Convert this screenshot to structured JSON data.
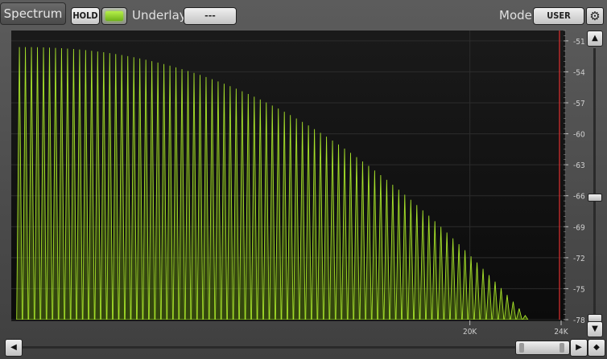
{
  "header": {
    "title": "Spectrum",
    "hold_label": "HOLD",
    "underlay_label": "Underlay",
    "underlay_value": "---",
    "mode_label": "Mode",
    "mode_value": "USER"
  },
  "colors": {
    "spectrum": "#a6e22a",
    "plot_bg": "#111111",
    "cursor_line": "#e03030",
    "led": "#8ad02a"
  },
  "icons": {
    "settings": "gear-icon",
    "scroll_up": "triangle-up-icon",
    "scroll_down": "triangle-down-icon",
    "scroll_left": "triangle-left-icon",
    "scroll_right": "triangle-right-icon",
    "zoom": "diamond-icon"
  },
  "axes": {
    "y_tick_labels": [
      "-51",
      "-54",
      "-57",
      "-60",
      "-63",
      "-66",
      "-69",
      "-72",
      "-75",
      "-78"
    ],
    "x_tick_labels": [
      "20K",
      "24K"
    ]
  },
  "chart_data": {
    "type": "bar",
    "xlabel": "",
    "ylabel": "",
    "xlim": [
      0,
      24000
    ],
    "ylim": [
      -78,
      -50
    ],
    "x_ticks": [
      20000,
      24000
    ],
    "y_ticks": [
      -51,
      -54,
      -57,
      -60,
      -63,
      -66,
      -69,
      -72,
      -75,
      -78
    ],
    "grid": true,
    "first_peak_hz": 250,
    "peak_spacing_hz": 264,
    "peak_count": 85,
    "peak_level_start_db": -51.6,
    "peak_level_end_db": -77.6,
    "cursor_x_hz": 24000
  }
}
